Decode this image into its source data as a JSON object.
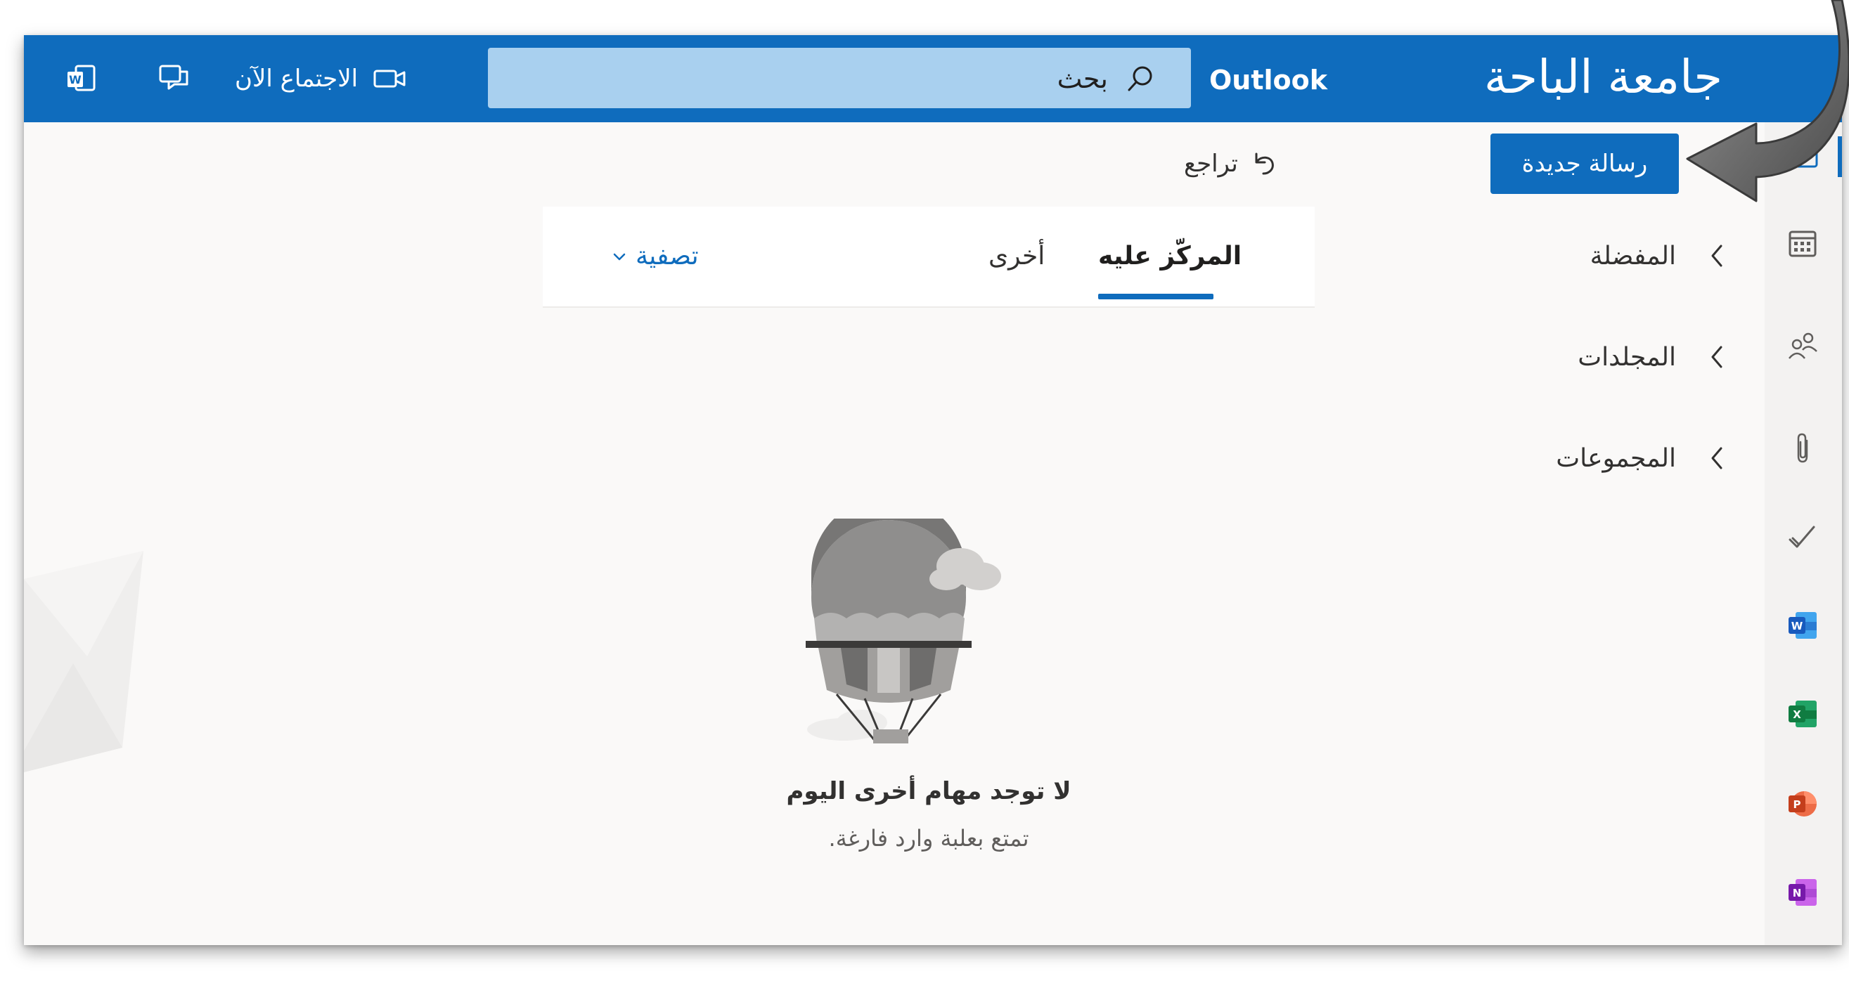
{
  "header": {
    "org_title": "جامعة الباحة",
    "app_name": "Outlook",
    "search_placeholder": "بحث",
    "meet_now_label": "الاجتماع الآن"
  },
  "commandbar": {
    "new_mail_label": "رسالة جديدة",
    "undo_label": "تراجع"
  },
  "folders": [
    {
      "label": "المفضلة"
    },
    {
      "label": "المجلدات"
    },
    {
      "label": "المجموعات"
    }
  ],
  "message_list": {
    "tab_focused": "المركّز عليه",
    "tab_other": "أخرى",
    "filter_label": "تصفية",
    "empty_title": "لا توجد مهام أخرى اليوم",
    "empty_subtitle": "تمتع بعلبة وارد فارغة."
  },
  "rail": {
    "icons": [
      "mail-icon",
      "calendar-icon",
      "people-icon",
      "attachment-icon",
      "todo-icon",
      "word-icon",
      "excel-icon",
      "powerpoint-icon",
      "onenote-icon"
    ]
  },
  "colors": {
    "brand_blue": "#0f6cbd",
    "search_bg": "#a9d0ef",
    "word": "#185abd",
    "excel": "#107c41",
    "powerpoint": "#c43e1c",
    "onenote": "#7719aa"
  }
}
